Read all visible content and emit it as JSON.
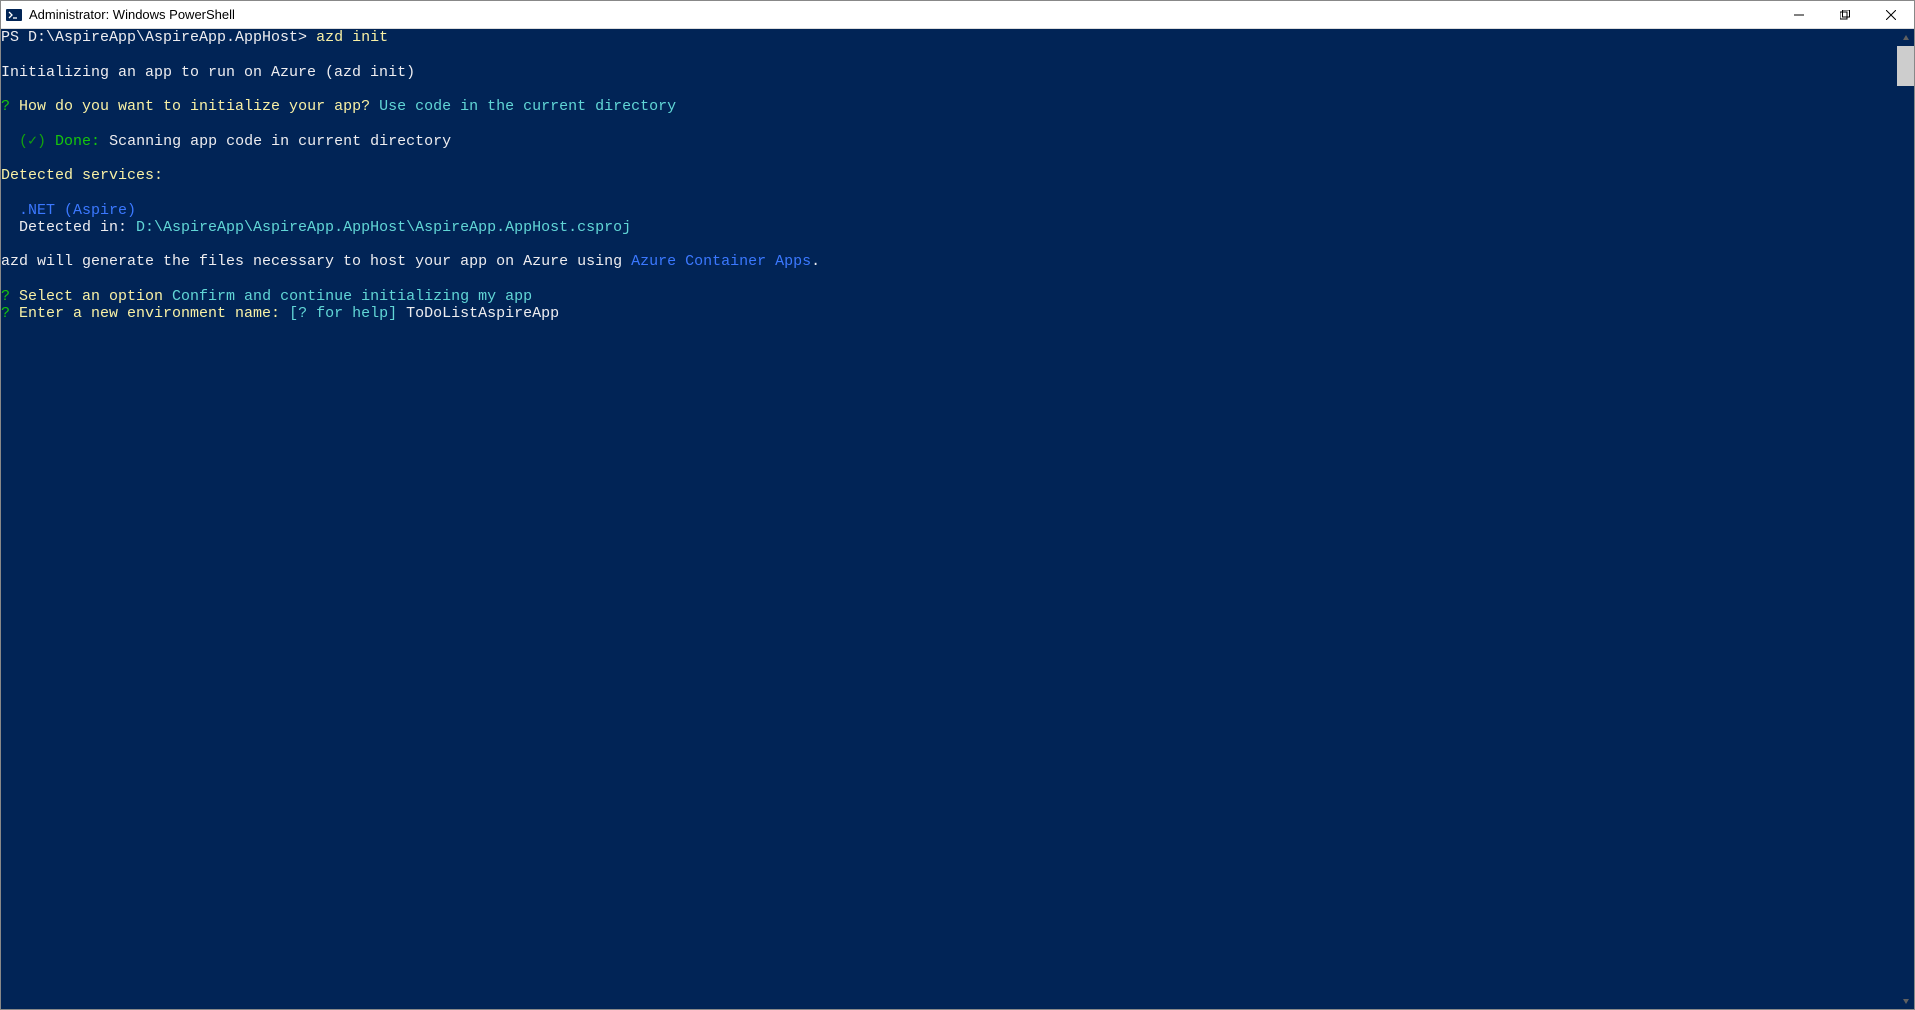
{
  "window": {
    "title": "Administrator: Windows PowerShell"
  },
  "terminal": {
    "prompt_prefix": "PS D:\\AspireApp\\AspireApp.AppHost> ",
    "command": "azd init",
    "blank": " ",
    "init_header": "Initializing an app to run on Azure (azd init)",
    "q_marker": "?",
    "q1_text": " How do you want to initialize your app?",
    "q1_answer": " Use code in the current directory",
    "done_time": "  (✓) ",
    "done_label": "Done:",
    "done_text": " Scanning app code in current directory",
    "detected_header": "Detected services:",
    "service_line": "  .NET (Aspire)",
    "detected_in_label": "  Detected in: ",
    "detected_in_path": "D:\\AspireApp\\AspireApp.AppHost\\AspireApp.AppHost.csproj",
    "generate_text1": "azd will generate the files necessary to host your app on Azure using ",
    "generate_link": "Azure Container Apps",
    "generate_text2": ".",
    "q2_text": " Select an option",
    "q2_answer": " Confirm and continue initializing my app",
    "q3_text": " Enter a new environment name:",
    "q3_help": " [? for help]",
    "q3_input": " ToDoListAspireApp"
  }
}
